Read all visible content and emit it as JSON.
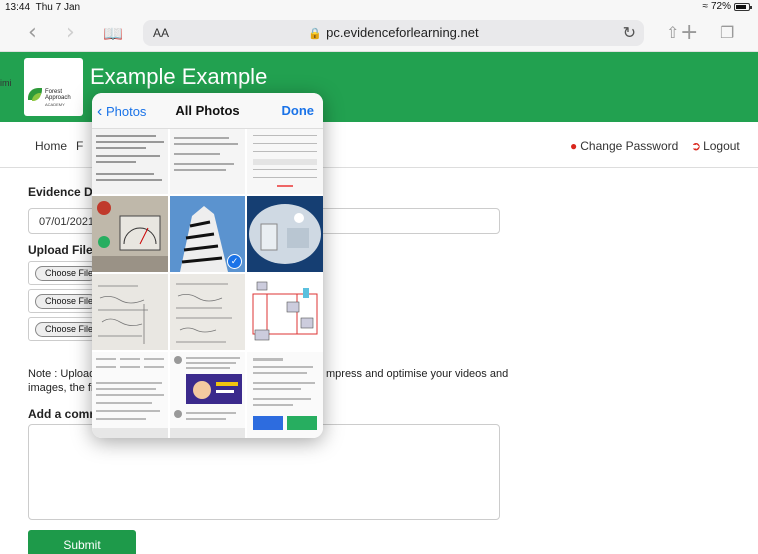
{
  "status": {
    "time": "13:44",
    "day": "Thu 7 Jan",
    "battery": "72%"
  },
  "browser": {
    "url": "pc.evidenceforlearning.net",
    "text_size": "AA"
  },
  "header": {
    "site_title": "Example Example",
    "logo_line1": "Forest",
    "logo_line2": "Approach",
    "logo_line3": "ACADEMY",
    "side_cut": "imi"
  },
  "nav": {
    "home": "Home",
    "cut": "F",
    "change_password": "Change Password",
    "logout": "Logout"
  },
  "form": {
    "evidence_date_label": "Evidence Dat",
    "evidence_date_value": "07/01/2021",
    "upload_label": "Upload File(s",
    "choose_file": "Choose File",
    "note_line1_start": "Note : Uploade",
    "note_line1_end": "mpress and optimise your videos and",
    "note_line2": "images, the fil",
    "comment_label": "Add a comme",
    "submit": "Submit"
  },
  "picker": {
    "back": "Photos",
    "title": "All Photos",
    "done": "Done"
  },
  "colors": {
    "brand_green": "#22a150",
    "accent_blue": "#1a73e8",
    "logout_red": "#d9261c"
  }
}
